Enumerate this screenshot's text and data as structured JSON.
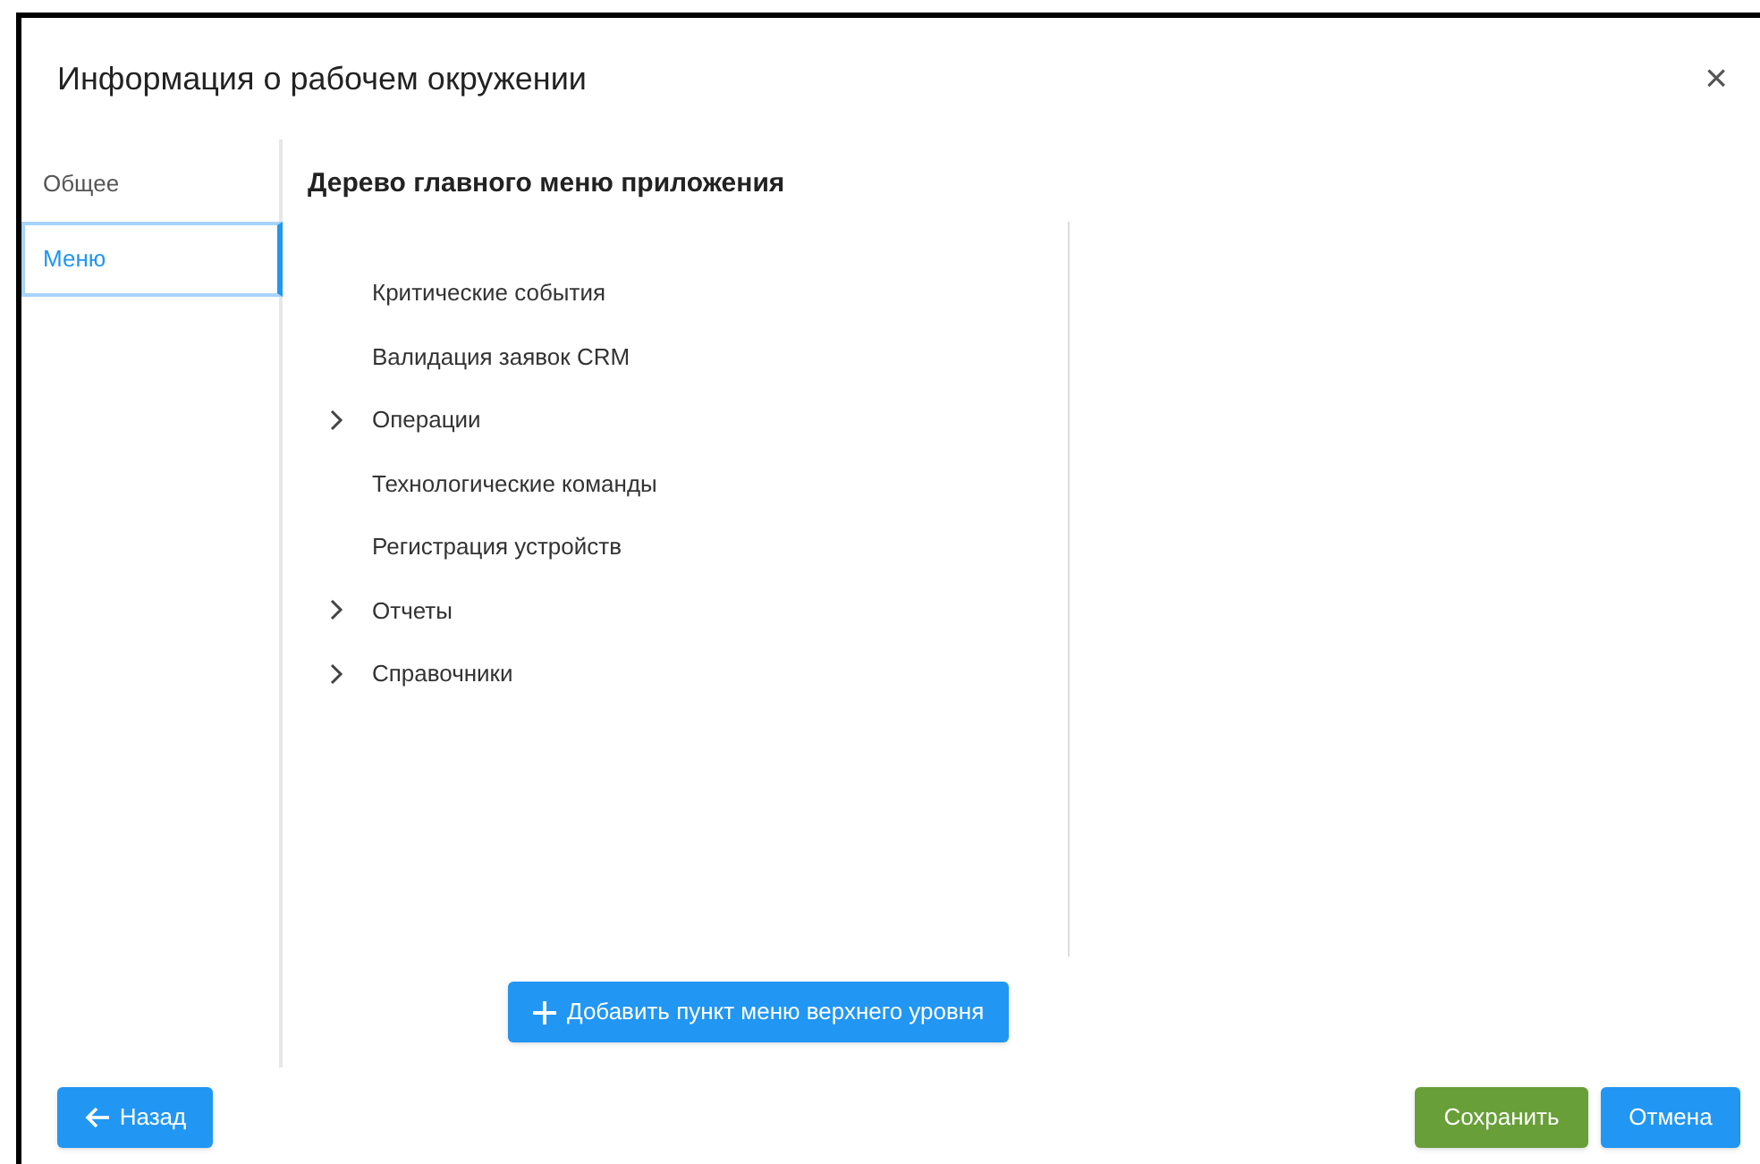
{
  "dialog": {
    "title": "Информация о рабочем окружении",
    "close": "×"
  },
  "tabs": [
    {
      "label": "Общее",
      "selected": false
    },
    {
      "label": "Меню",
      "selected": true
    }
  ],
  "panel": {
    "heading": "Дерево главного меню приложения"
  },
  "tree": [
    {
      "label": "Критические события",
      "kind": "leaf"
    },
    {
      "label": "Валидация заявок CRM",
      "kind": "leaf"
    },
    {
      "label": "Операции",
      "kind": "group",
      "expanded": false
    },
    {
      "label": "Технологические команды",
      "kind": "leaf"
    },
    {
      "label": "Регистрация устройств",
      "kind": "leaf"
    },
    {
      "label": "Отчеты",
      "kind": "group",
      "expanded": false
    },
    {
      "label": "Справочники",
      "kind": "group",
      "expanded": false
    }
  ],
  "add_button": "Добавить пункт меню верхнего уровня",
  "footer": {
    "back": "Назад",
    "save": "Сохранить",
    "cancel": "Отмена"
  }
}
